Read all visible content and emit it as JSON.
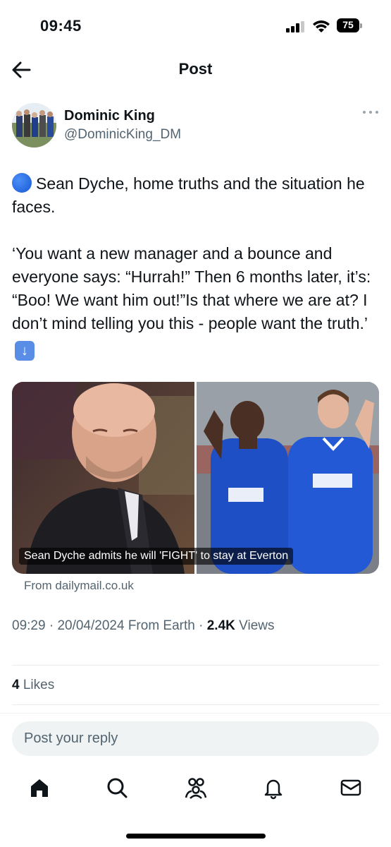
{
  "status_bar": {
    "time": "09:45",
    "battery": "75",
    "icons": [
      "signal-icon",
      "wifi-icon",
      "battery-icon"
    ]
  },
  "header": {
    "title": "Post",
    "back_icon": "arrow-left-icon"
  },
  "author": {
    "name": "Dominic King",
    "handle": "@DominicKing_DM",
    "more_icon": "more-horizontal-icon"
  },
  "tweet": {
    "line1": "Sean Dyche, home truths and the situation he faces.",
    "line2": "‘You want a new manager and a bounce and everyone says: “Hurrah!” Then 6 months later, it’s: “Boo! We want him out!”Is that where we are at? I don’t mind telling you this - people want the truth.’",
    "emoji_start": "blue-circle-emoji",
    "emoji_end": "down-arrow-emoji"
  },
  "media": {
    "caption": "Sean Dyche admits he will 'FIGHT' to stay at Everton",
    "source": "From dailymail.co.uk"
  },
  "meta": {
    "time": "09:29",
    "date": "20/04/2024",
    "location": "From Earth",
    "views_count": "2.4K",
    "views_label": "Views"
  },
  "engagement": {
    "likes_count": "4",
    "likes_label": "Likes"
  },
  "reply": {
    "placeholder": "Post your reply"
  },
  "tab_bar": {
    "tabs": [
      "home-icon",
      "search-icon",
      "communities-icon",
      "notifications-icon",
      "messages-icon"
    ]
  },
  "colors": {
    "text_primary": "#0f1419",
    "text_secondary": "#536471",
    "divider": "#e6ecf0",
    "input_bg": "#eff3f4"
  }
}
